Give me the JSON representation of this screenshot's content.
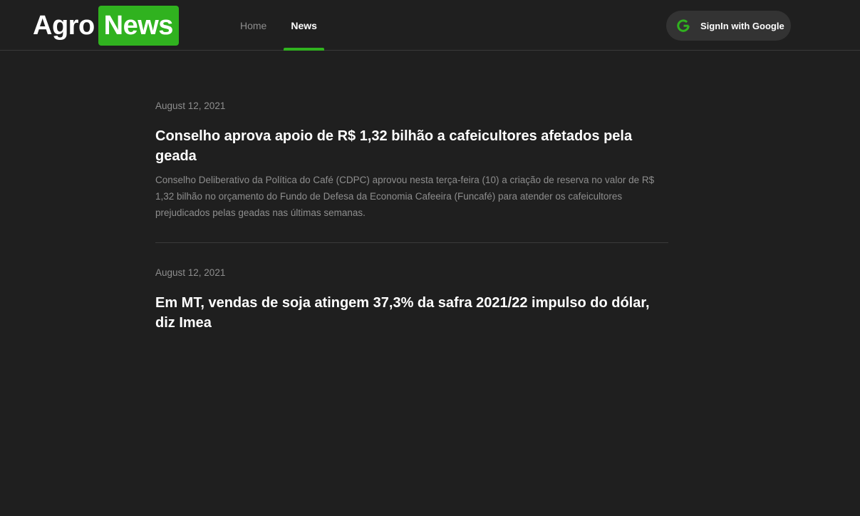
{
  "brand": {
    "part1": "Agro",
    "part2": "News",
    "accent_color": "#30b21f"
  },
  "nav": {
    "items": [
      {
        "label": "Home",
        "active": false
      },
      {
        "label": "News",
        "active": true
      }
    ]
  },
  "signin": {
    "label": "SignIn with Google",
    "icon": "google-g-icon"
  },
  "articles": [
    {
      "date": "August 12, 2021",
      "title": "Conselho aprova apoio de R$ 1,32 bilhão a cafeicultores afetados pela geada",
      "summary": "Conselho Deliberativo da Política do Café (CDPC) aprovou nesta terça-feira (10) a criação de reserva no valor de R$ 1,32 bilhão no orçamento do Fundo de Defesa da Economia Cafeeira (Funcafé) para atender os cafeicultores prejudicados pelas geadas nas últimas semanas."
    },
    {
      "date": "August 12, 2021",
      "title": "Em MT, vendas de soja atingem 37,3% da safra 2021/22 impulso do dólar, diz Imea"
    }
  ]
}
